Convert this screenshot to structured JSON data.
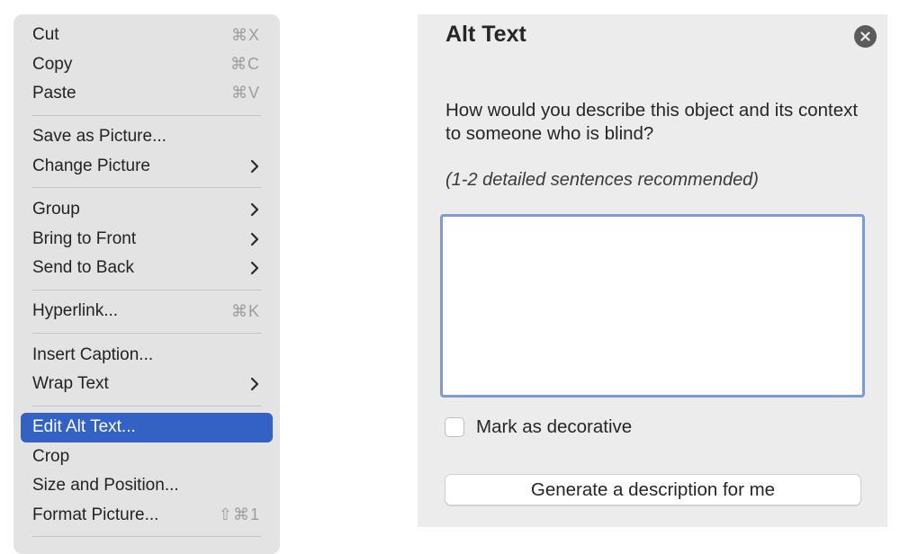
{
  "context_menu": {
    "items": [
      {
        "label": "Cut",
        "shortcut": "⌘X"
      },
      {
        "label": "Copy",
        "shortcut": "⌘C"
      },
      {
        "label": "Paste",
        "shortcut": "⌘V"
      },
      {
        "label": "Save as Picture..."
      },
      {
        "label": "Change Picture",
        "submenu": true
      },
      {
        "label": "Group",
        "submenu": true
      },
      {
        "label": "Bring to Front",
        "submenu": true
      },
      {
        "label": "Send to Back",
        "submenu": true
      },
      {
        "label": "Hyperlink...",
        "shortcut": "⌘K"
      },
      {
        "label": "Insert Caption..."
      },
      {
        "label": "Wrap Text",
        "submenu": true
      },
      {
        "label": "Edit Alt Text...",
        "selected": true
      },
      {
        "label": "Crop"
      },
      {
        "label": "Size and Position..."
      },
      {
        "label": "Format Picture...",
        "shortcut": "⇧⌘1"
      }
    ],
    "chevron_icon": "chevron-right-icon",
    "selected_color": "#3462c4"
  },
  "alt_text_panel": {
    "title": "Alt Text",
    "close_icon": "close-icon",
    "prompt": "How would you describe this object and its context to someone who is blind?",
    "hint": "(1-2 detailed sentences recommended)",
    "description_value": "",
    "decorative_label": "Mark as decorative",
    "decorative_checked": false,
    "generate_button_label": "Generate a description for me",
    "focus_border_color": "#7f9bd0"
  }
}
